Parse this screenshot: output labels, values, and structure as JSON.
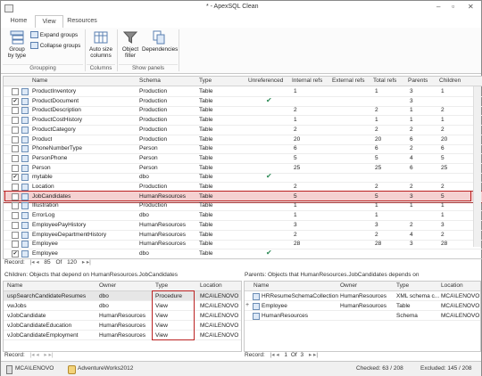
{
  "window": {
    "title": "* - ApexSQL Clean",
    "controls": {
      "minimize": "–",
      "restore": "▫",
      "close": "✕"
    }
  },
  "ribbon_tabs": [
    "Home",
    "View",
    "Resources"
  ],
  "ribbon": {
    "grouping": {
      "group_by_type": "Group by type",
      "expand_groups": "Expand groups",
      "collapse_groups": "Collapse groups",
      "label": "Groupping"
    },
    "columns": {
      "auto_size": "Auto size columns",
      "label": "Columns"
    },
    "panels": {
      "object_filter": "Object filter",
      "dependencies": "Dependencies",
      "label": "Show panels"
    }
  },
  "main_grid": {
    "columns": [
      "Name",
      "Schema",
      "Type",
      "Unreferenced",
      "Internal refs",
      "External refs",
      "Total refs",
      "Parents",
      "Children"
    ],
    "rows": [
      {
        "checked": false,
        "name": "ProductInventory",
        "schema": "Production",
        "type": "Table",
        "unref": "",
        "internal": "1",
        "external": "",
        "total": "1",
        "parents": "3",
        "children": "1"
      },
      {
        "checked": true,
        "name": "ProductDocument",
        "schema": "Production",
        "type": "Table",
        "unref": "✔",
        "internal": "",
        "external": "",
        "total": "",
        "parents": "3",
        "children": ""
      },
      {
        "checked": false,
        "name": "ProductDescription",
        "schema": "Production",
        "type": "Table",
        "unref": "",
        "internal": "2",
        "external": "",
        "total": "2",
        "parents": "1",
        "children": "2"
      },
      {
        "checked": false,
        "name": "ProductCostHistory",
        "schema": "Production",
        "type": "Table",
        "unref": "",
        "internal": "1",
        "external": "",
        "total": "1",
        "parents": "1",
        "children": "1"
      },
      {
        "checked": false,
        "name": "ProductCategory",
        "schema": "Production",
        "type": "Table",
        "unref": "",
        "internal": "2",
        "external": "",
        "total": "2",
        "parents": "2",
        "children": "2"
      },
      {
        "checked": false,
        "name": "Product",
        "schema": "Production",
        "type": "Table",
        "unref": "",
        "internal": "20",
        "external": "",
        "total": "20",
        "parents": "6",
        "children": "20"
      },
      {
        "checked": false,
        "name": "PhoneNumberType",
        "schema": "Person",
        "type": "Table",
        "unref": "",
        "internal": "6",
        "external": "",
        "total": "6",
        "parents": "2",
        "children": "6"
      },
      {
        "checked": false,
        "name": "PersonPhone",
        "schema": "Person",
        "type": "Table",
        "unref": "",
        "internal": "5",
        "external": "",
        "total": "5",
        "parents": "4",
        "children": "5"
      },
      {
        "checked": false,
        "name": "Person",
        "schema": "Person",
        "type": "Table",
        "unref": "",
        "internal": "25",
        "external": "",
        "total": "25",
        "parents": "6",
        "children": "25"
      },
      {
        "checked": true,
        "name": "mytable",
        "schema": "dbo",
        "type": "Table",
        "unref": "✔",
        "internal": "",
        "external": "",
        "total": "",
        "parents": "",
        "children": ""
      },
      {
        "checked": false,
        "name": "Location",
        "schema": "Production",
        "type": "Table",
        "unref": "",
        "internal": "2",
        "external": "",
        "total": "2",
        "parents": "2",
        "children": "2"
      },
      {
        "checked": false,
        "name": "JobCandidates",
        "schema": "HumanResources",
        "type": "Table",
        "unref": "",
        "internal": "5",
        "external": "",
        "total": "5",
        "parents": "3",
        "children": "5",
        "selected": true
      },
      {
        "checked": false,
        "name": "Illustration",
        "schema": "Production",
        "type": "Table",
        "unref": "",
        "internal": "1",
        "external": "",
        "total": "1",
        "parents": "1",
        "children": "1"
      },
      {
        "checked": false,
        "name": "ErrorLog",
        "schema": "dbo",
        "type": "Table",
        "unref": "",
        "internal": "1",
        "external": "",
        "total": "1",
        "parents": "",
        "children": "1"
      },
      {
        "checked": false,
        "name": "EmployeePayHistory",
        "schema": "HumanResources",
        "type": "Table",
        "unref": "",
        "internal": "3",
        "external": "",
        "total": "3",
        "parents": "2",
        "children": "3"
      },
      {
        "checked": false,
        "name": "EmployeeDepartmentHistory",
        "schema": "HumanResources",
        "type": "Table",
        "unref": "",
        "internal": "2",
        "external": "",
        "total": "2",
        "parents": "4",
        "children": "2"
      },
      {
        "checked": false,
        "name": "Employee",
        "schema": "HumanResources",
        "type": "Table",
        "unref": "",
        "internal": "28",
        "external": "",
        "total": "28",
        "parents": "3",
        "children": "28"
      },
      {
        "checked": true,
        "name": "Employee",
        "schema": "dbo",
        "type": "Table",
        "unref": "✔",
        "internal": "",
        "external": "",
        "total": "",
        "parents": "",
        "children": ""
      }
    ],
    "record_label": "Record:",
    "record_pos": "85",
    "record_of": "Of",
    "record_total": "120"
  },
  "children_panel": {
    "title": "Children: Objects that depend on HumanResources.JobCandidates",
    "columns": [
      "Name",
      "Owner",
      "Type",
      "Location"
    ],
    "rows": [
      {
        "name": "uspSearchCandidateResumes",
        "owner": "dbo",
        "type": "Procedure",
        "location": "MCA\\LENOVO"
      },
      {
        "name": "vwJobs",
        "owner": "dbo",
        "type": "View",
        "location": "MCA\\LENOVO"
      },
      {
        "name": "vJobCandidate",
        "owner": "HumanResources",
        "type": "View",
        "location": "MCA\\LENOVO"
      },
      {
        "name": "vJobCandidateEducation",
        "owner": "HumanResources",
        "type": "View",
        "location": "MCA\\LENOVO"
      },
      {
        "name": "vJobCandidateEmployment",
        "owner": "HumanResources",
        "type": "View",
        "location": "MCA\\LENOVO"
      }
    ],
    "record_label": "Record:"
  },
  "parents_panel": {
    "title": "Parents: Objects that HumanResources.JobCandidates depends on",
    "columns": [
      "Name",
      "Owner",
      "Type",
      "Location"
    ],
    "rows": [
      {
        "name": "HRResumeSchemaCollection",
        "owner": "HumanResources",
        "type": "XML schema c...",
        "location": "MCA\\LENOVO"
      },
      {
        "name": "Employee",
        "owner": "HumanResources",
        "type": "Table",
        "location": "MCA\\LENOVO"
      },
      {
        "name": "HumanResources",
        "owner": "",
        "type": "Schema",
        "location": "MCA\\LENOVO"
      }
    ],
    "record_label": "Record:",
    "record_pos": "1",
    "record_of": "Of",
    "record_total": "3"
  },
  "statusbar": {
    "server": "MCA\\LENOVO",
    "database": "AdventureWorks2012",
    "checked": "Checked: 63 / 208",
    "excluded": "Excluded: 145 / 208"
  }
}
